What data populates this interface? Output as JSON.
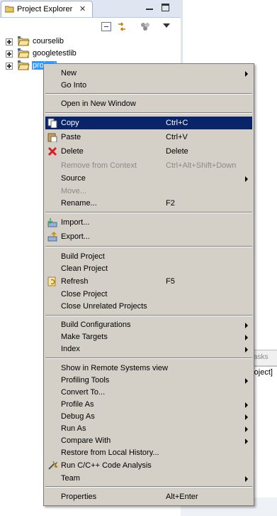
{
  "view": {
    "tab_title": "Project Explorer",
    "tab_close": "✕"
  },
  "tree": [
    {
      "name": "courselib",
      "selected": false
    },
    {
      "name": "googletestlib",
      "selected": false
    },
    {
      "name": "project",
      "selected": true
    }
  ],
  "background": {
    "tasks_tab_label": "asks",
    "project_fragment": "roject]"
  },
  "menu": {
    "items": [
      {
        "label": "New",
        "submenu": true
      },
      {
        "label": "Go Into"
      },
      {
        "label": "Open in New Window"
      },
      {
        "label": "Copy",
        "shortcut": "Ctrl+C",
        "icon": "copy-icon",
        "highlighted": true
      },
      {
        "label": "Paste",
        "shortcut": "Ctrl+V",
        "icon": "paste-icon"
      },
      {
        "label": "Delete",
        "shortcut": "Delete",
        "icon": "delete-icon"
      },
      {
        "label": "Remove from Context",
        "shortcut": "Ctrl+Alt+Shift+Down",
        "disabled": true
      },
      {
        "label": "Source",
        "submenu": true
      },
      {
        "label": "Move...",
        "disabled": true
      },
      {
        "label": "Rename...",
        "shortcut": "F2"
      },
      {
        "label": "Import...",
        "icon": "import-icon"
      },
      {
        "label": "Export...",
        "icon": "export-icon"
      },
      {
        "label": "Build Project"
      },
      {
        "label": "Clean Project"
      },
      {
        "label": "Refresh",
        "shortcut": "F5",
        "icon": "refresh-icon"
      },
      {
        "label": "Close Project"
      },
      {
        "label": "Close Unrelated Projects"
      },
      {
        "label": "Build Configurations",
        "submenu": true
      },
      {
        "label": "Make Targets",
        "submenu": true
      },
      {
        "label": "Index",
        "submenu": true
      },
      {
        "label": "Show in Remote Systems view"
      },
      {
        "label": "Profiling Tools",
        "submenu": true
      },
      {
        "label": "Convert To..."
      },
      {
        "label": "Profile As",
        "submenu": true
      },
      {
        "label": "Debug As",
        "submenu": true
      },
      {
        "label": "Run As",
        "submenu": true
      },
      {
        "label": "Compare With",
        "submenu": true
      },
      {
        "label": "Restore from Local History..."
      },
      {
        "label": "Run C/C++ Code Analysis",
        "icon": "code-analysis-icon"
      },
      {
        "label": "Team",
        "submenu": true
      },
      {
        "label": "Properties",
        "shortcut": "Alt+Enter"
      }
    ]
  },
  "colors": {
    "menu_bg": "#d4d0c8",
    "highlight_bg": "#0a246a",
    "selection_bg": "#3399ff",
    "disabled_text": "#8d8a84"
  }
}
